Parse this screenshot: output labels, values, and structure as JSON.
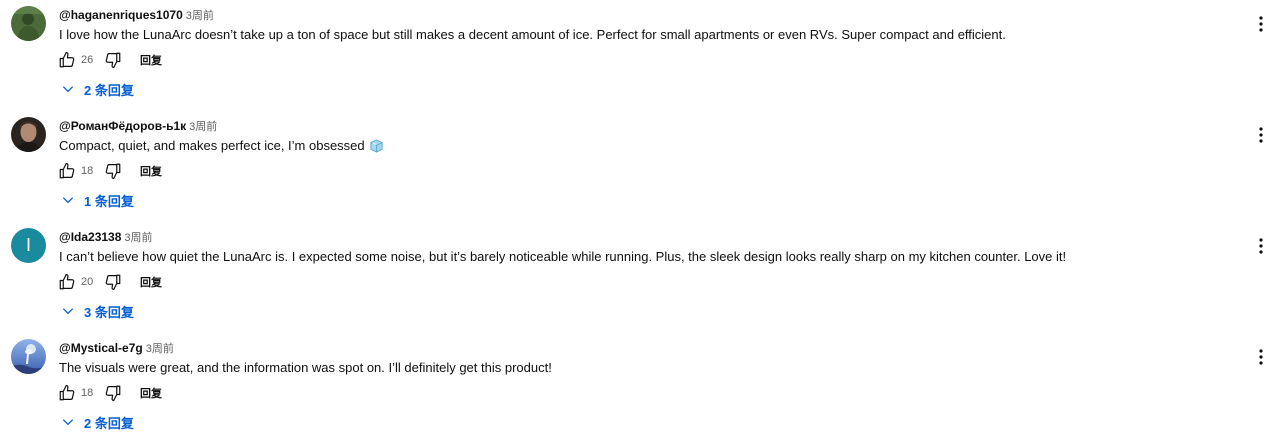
{
  "comments": [
    {
      "author": "@haganenriques1070",
      "time": "3周前",
      "text": "I love how the LunaArc doesn’t take up a ton of space but still makes a decent amount of ice. Perfect for small apartments or even RVs. Super compact and efficient.",
      "likes": "26",
      "reply_label": "回复",
      "replies_label": "2 条回复",
      "avatar": "photo-green"
    },
    {
      "author": "@РоманФёдоров-ь1к",
      "time": "3周前",
      "text": "Compact, quiet, and makes perfect ice, I’m obsessed",
      "emoji": "ice-cube-icon",
      "likes": "18",
      "reply_label": "回复",
      "replies_label": "1 条回复",
      "avatar": "photo-portrait"
    },
    {
      "author": "@Ida23138",
      "time": "3周前",
      "text": "I can’t believe how quiet the LunaArc is. I expected some noise, but it’s barely noticeable while running. Plus, the sleek design looks really sharp on my kitchen counter. Love it!",
      "likes": "20",
      "reply_label": "回复",
      "replies_label": "3 条回复",
      "avatar_letter": "I",
      "avatar_color": "#1a8a9f"
    },
    {
      "author": "@Mystical-e7g",
      "time": "3周前",
      "text": "The visuals were great, and the information was spot on. I’ll definitely get this product!",
      "likes": "18",
      "reply_label": "回复",
      "replies_label": "2 条回复",
      "avatar": "photo-bird"
    }
  ],
  "colors": {
    "link": "#065fd4",
    "meta": "#606060",
    "text": "#0f0f0f"
  }
}
